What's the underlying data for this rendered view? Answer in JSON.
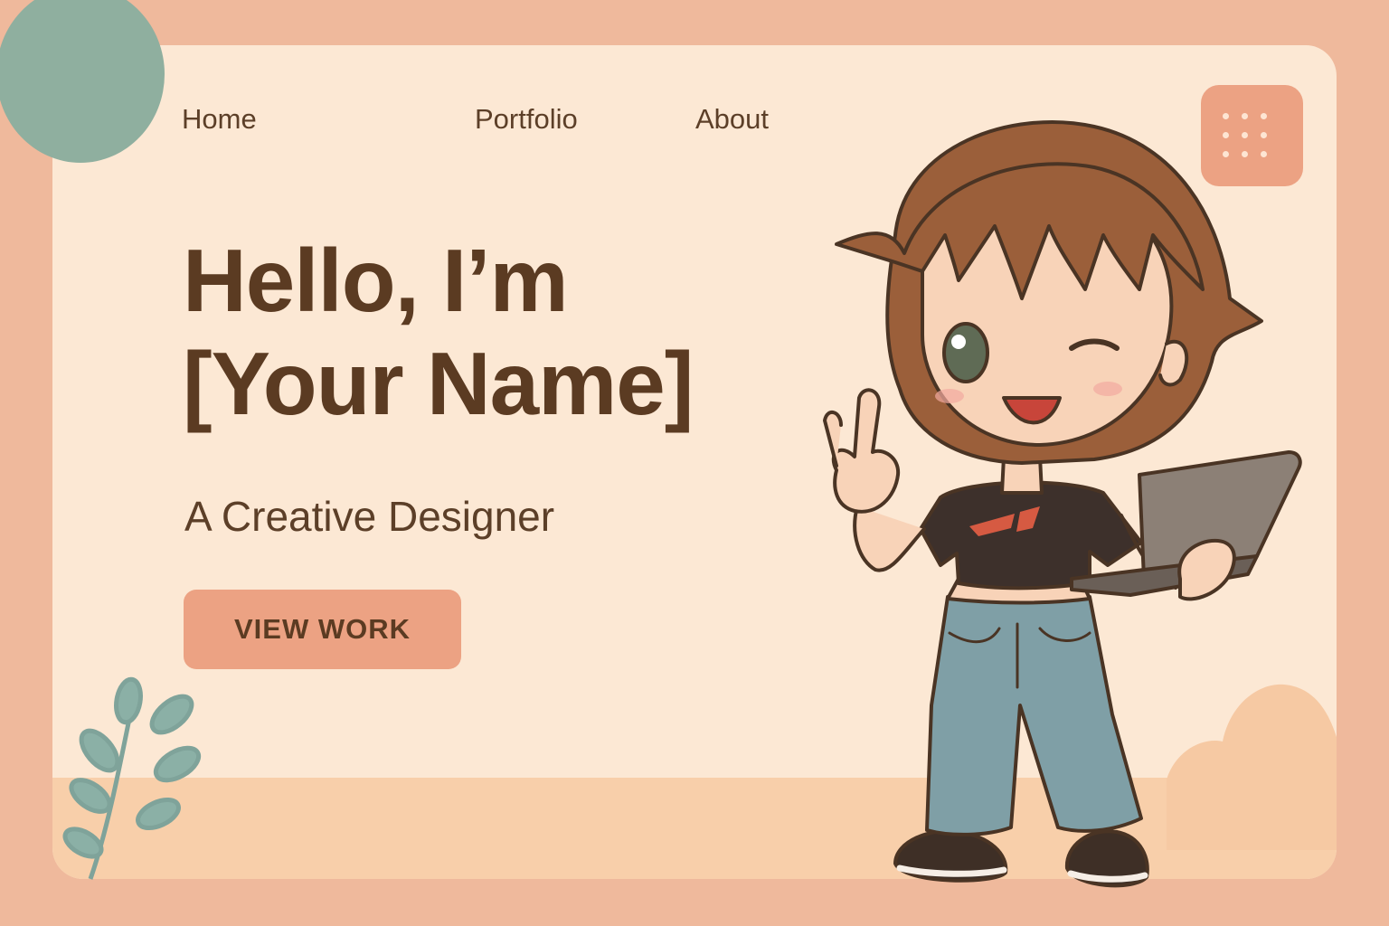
{
  "nav": {
    "items": [
      {
        "label": "Home"
      },
      {
        "label": "Portfolio"
      },
      {
        "label": "About"
      }
    ],
    "menu_icon": "grid-dots-icon"
  },
  "hero": {
    "headline_line1": "Hello, I’m",
    "headline_line2": "[Your Name]",
    "subtitle": "A Creative Designer",
    "cta_label": "VIEW WORK"
  },
  "illustration": {
    "character": "chibi-designer-with-laptop",
    "shirt_logo": "F1"
  },
  "colors": {
    "background": "#efb99c",
    "card": "#fce8d4",
    "accent": "#eca283",
    "text": "#5b3b22",
    "sage": "#8faf9f"
  }
}
